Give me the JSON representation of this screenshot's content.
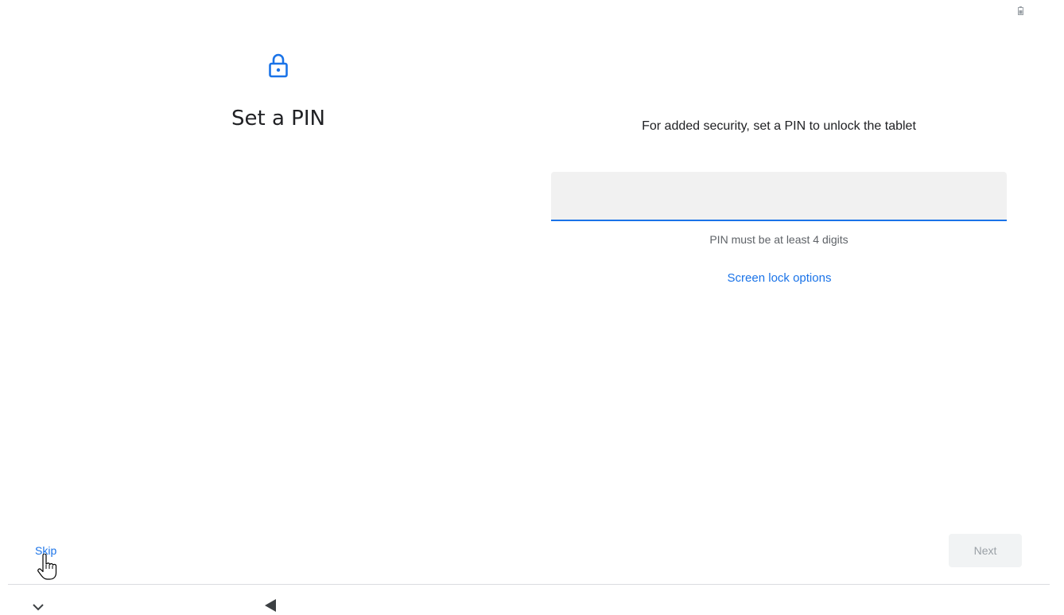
{
  "header": {
    "title": "Set a PIN",
    "lock_icon": "lock-icon"
  },
  "main": {
    "description": "For added security, set a PIN to unlock the tablet",
    "pin_input": {
      "value": "",
      "placeholder": ""
    },
    "hint": "PIN must be at least 4 digits",
    "screen_lock_options_label": "Screen lock options"
  },
  "footer": {
    "skip_label": "Skip",
    "next_label": "Next"
  },
  "navbar": {
    "collapse_icon": "chevron-down-icon",
    "back_icon": "back-triangle-icon"
  },
  "colors": {
    "accent": "#1a73e8",
    "field_bg": "#f1f1f1",
    "disabled_button_bg": "#f1f3f4",
    "disabled_text": "#9aa0a6"
  }
}
